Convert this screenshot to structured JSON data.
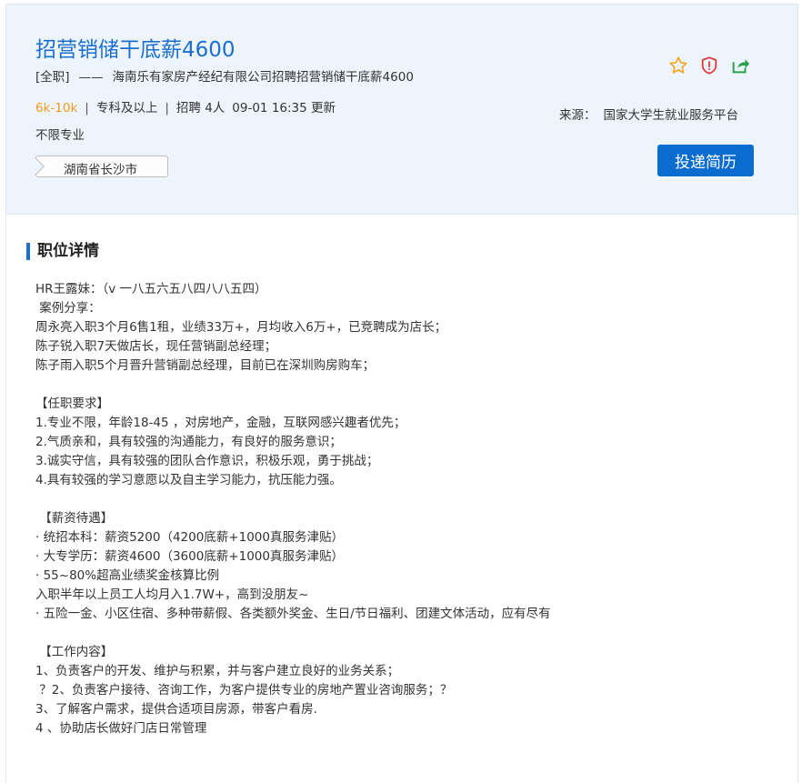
{
  "header": {
    "title": "招营销储干底薪4600",
    "job_type": "[全职]",
    "dash": "——",
    "company_text": "海南乐有家房产经纪有限公司招聘招营销储干底薪4600",
    "salary": "6k-10k",
    "separator": "|",
    "education": "专科及以上",
    "headcount": "招聘 4人",
    "updated": "09-01 16:35 更新",
    "major": "不限专业",
    "location": "湖南省长沙市",
    "source_label": "来源：",
    "source_value": "国家大学生就业服务平台",
    "apply_label": "投递简历",
    "icons": [
      "star-icon",
      "report-shield-icon",
      "share-icon"
    ],
    "colors": {
      "accent": "#1a6fcf",
      "salary": "#f39a1e",
      "button": "#0a6ccf",
      "star": "#f5a623",
      "shield": "#e23b3b",
      "share": "#2aa14a"
    }
  },
  "details": {
    "heading": "职位详情",
    "lines": [
      "HR王露妹：（v 一八五六五八四八八五四）",
      " 案例分享：",
      "周永亮入职3个月6售1租，业绩33万+，月均收入6万+，已竞聘成为店长；",
      "陈子锐入职7天做店长，现任营销副总经理；",
      "陈子雨入职5个月晋升营销副总经理，目前已在深圳购房购车；",
      "",
      "【任职要求】",
      "1.专业不限，年龄18-45 ，对房地产，金融，互联网感兴趣者优先；",
      "2.气质亲和，具有较强的沟通能力，有良好的服务意识；",
      "3.诚实守信，具有较强的团队合作意识，积极乐观，勇于挑战；",
      "4.具有较强的学习意愿以及自主学习能力，抗压能力强。",
      "",
      " 【薪资待遇】",
      "· 统招本科：薪资5200（4200底薪+1000真服务津贴）",
      "· 大专学历：薪资4600（3600底薪+1000真服务津贴）",
      "· 55~80%超高业绩奖金核算比例",
      "入职半年以上员工人均月入1.7W+，高到没朋友~",
      "· 五险一金、小区住宿、多种带薪假、各类额外奖金、生日/节日福利、团建文体活动，应有尽有",
      "",
      " 【工作内容】",
      "1、负责客户的开发、维护与积累，并与客户建立良好的业务关系；",
      " ？2、负责客户接待、咨询工作，为客户提供专业的房地产置业咨询服务；？",
      "3、了解客户需求，提供合适项目房源，带客户看房.",
      "4 、协助店长做好门店日常管理"
    ]
  }
}
